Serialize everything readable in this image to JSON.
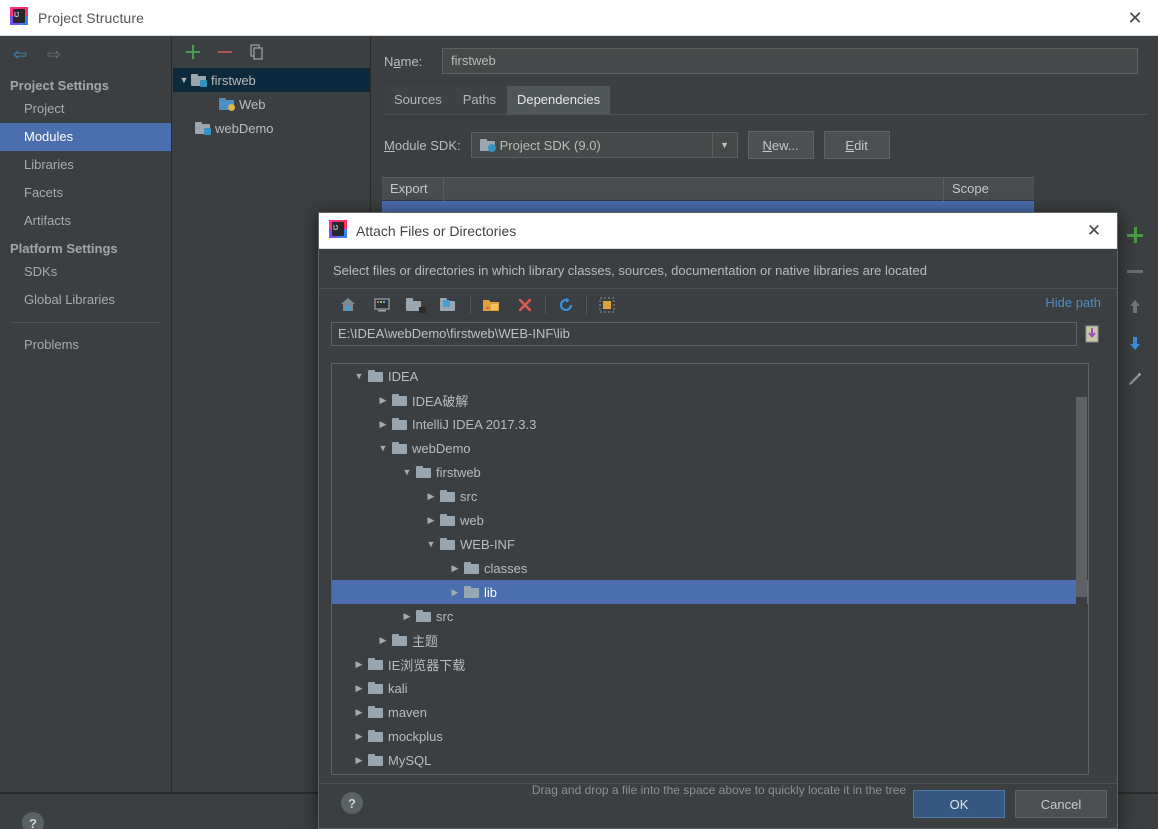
{
  "window": {
    "title": "Project Structure",
    "icon": "intellij-idea-logo",
    "close_label": "✕"
  },
  "nav": {
    "back_icon": "arrow-left-icon",
    "forward_icon": "arrow-right-icon",
    "back_glyph": "⇦",
    "forward_glyph": "⇨"
  },
  "sidebar": {
    "groups": [
      {
        "label": "Project Settings",
        "items": [
          {
            "label": "Project",
            "selected": false
          },
          {
            "label": "Modules",
            "selected": true
          },
          {
            "label": "Libraries",
            "selected": false
          },
          {
            "label": "Facets",
            "selected": false
          },
          {
            "label": "Artifacts",
            "selected": false
          }
        ]
      },
      {
        "label": "Platform Settings",
        "items": [
          {
            "label": "SDKs",
            "selected": false
          },
          {
            "label": "Global Libraries",
            "selected": false
          }
        ]
      }
    ],
    "problems": {
      "label": "Problems",
      "selected": false
    }
  },
  "modules_panel": {
    "toolbar": [
      {
        "icon": "plus-icon",
        "name": "add-module-button"
      },
      {
        "icon": "minus-icon",
        "name": "remove-module-button"
      },
      {
        "icon": "copy-icon",
        "name": "copy-module-button"
      }
    ],
    "tree": [
      {
        "label": "firstweb",
        "depth": 0,
        "expanded": true,
        "arrow": "▼",
        "selected": true,
        "icon": "module-folder-icon"
      },
      {
        "label": "Web",
        "depth": 2,
        "expanded": null,
        "arrow": "",
        "selected": false,
        "icon": "web-facet-icon"
      },
      {
        "label": "webDemo",
        "depth": 0,
        "expanded": null,
        "arrow": "",
        "selected": false,
        "icon": "module-folder-icon"
      }
    ]
  },
  "content": {
    "name_label": "Name:",
    "name_value": "firstweb",
    "tabs": [
      {
        "label": "Sources",
        "active": false
      },
      {
        "label": "Paths",
        "active": false
      },
      {
        "label": "Dependencies",
        "active": true
      }
    ],
    "sdk_label": "Module SDK:",
    "sdk_value": "Project SDK (9.0)",
    "sdk_dropdown_icon": "chevron-down-icon",
    "new_button": "New...",
    "edit_button": "Edit",
    "table_headers": {
      "export": "Export",
      "scope": "Scope"
    },
    "right_toolbar": [
      {
        "icon": "plus-icon",
        "name": "add-dependency-button"
      },
      {
        "icon": "minus-icon",
        "name": "remove-dependency-button"
      },
      {
        "icon": "arrow-up-icon",
        "name": "move-up-button"
      },
      {
        "icon": "arrow-down-icon",
        "name": "move-down-button"
      },
      {
        "icon": "pencil-icon",
        "name": "edit-dependency-button"
      }
    ]
  },
  "help": {
    "glyph": "?"
  },
  "dialog": {
    "title": "Attach Files or Directories",
    "icon": "intellij-idea-logo",
    "close_label": "✕",
    "description": "Select files or directories in which library classes, sources, documentation or native libraries are located",
    "toolbar": [
      {
        "icon": "home-icon",
        "name": "home-directory-button"
      },
      {
        "icon": "desktop-icon",
        "name": "desktop-directory-button"
      },
      {
        "icon": "project-folder-icon",
        "name": "project-directory-button"
      },
      {
        "icon": "module-folder-icon",
        "name": "module-directory-button"
      },
      {
        "icon": "new-folder-icon",
        "name": "new-folder-button"
      },
      {
        "icon": "delete-x-icon",
        "name": "delete-button"
      },
      {
        "icon": "refresh-icon",
        "name": "refresh-button"
      },
      {
        "icon": "hidden-files-icon",
        "name": "show-hidden-files-button"
      }
    ],
    "hide_path_label": "Hide path",
    "path_value": "E:\\IDEA\\webDemo\\firstweb\\WEB-INF\\lib",
    "path_dropdown_icon": "path-history-icon",
    "tree": [
      {
        "label": "IDEA",
        "depth": 1,
        "arrow": "▼",
        "selected": false
      },
      {
        "label": "IDEA破解",
        "depth": 2,
        "arrow": "▶",
        "selected": false
      },
      {
        "label": "IntelliJ IDEA 2017.3.3",
        "depth": 2,
        "arrow": "▶",
        "selected": false
      },
      {
        "label": "webDemo",
        "depth": 2,
        "arrow": "▼",
        "selected": false
      },
      {
        "label": "firstweb",
        "depth": 3,
        "arrow": "▼",
        "selected": false
      },
      {
        "label": "src",
        "depth": 4,
        "arrow": "▶",
        "selected": false
      },
      {
        "label": "web",
        "depth": 4,
        "arrow": "▶",
        "selected": false
      },
      {
        "label": "WEB-INF",
        "depth": 4,
        "arrow": "▼",
        "selected": false
      },
      {
        "label": "classes",
        "depth": 5,
        "arrow": "▶",
        "selected": false
      },
      {
        "label": "lib",
        "depth": 5,
        "arrow": "▶",
        "selected": true
      },
      {
        "label": "src",
        "depth": 3,
        "arrow": "▶",
        "selected": false
      },
      {
        "label": "主题",
        "depth": 2,
        "arrow": "▶",
        "selected": false
      },
      {
        "label": "IE浏览器下载",
        "depth": 1,
        "arrow": "▶",
        "selected": false
      },
      {
        "label": "kali",
        "depth": 1,
        "arrow": "▶",
        "selected": false
      },
      {
        "label": "maven",
        "depth": 1,
        "arrow": "▶",
        "selected": false
      },
      {
        "label": "mockplus",
        "depth": 1,
        "arrow": "▶",
        "selected": false
      },
      {
        "label": "MySQL",
        "depth": 1,
        "arrow": "▶",
        "selected": false
      }
    ],
    "hint": "Drag and drop a file into the space above to quickly locate it in the tree",
    "help_glyph": "?",
    "ok_label": "OK",
    "cancel_label": "Cancel"
  },
  "colors": {
    "selection_blue": "#4b6eaf",
    "accent_link": "#4b8ecb",
    "bg": "#3c3f41",
    "ok_button": "#365880"
  }
}
